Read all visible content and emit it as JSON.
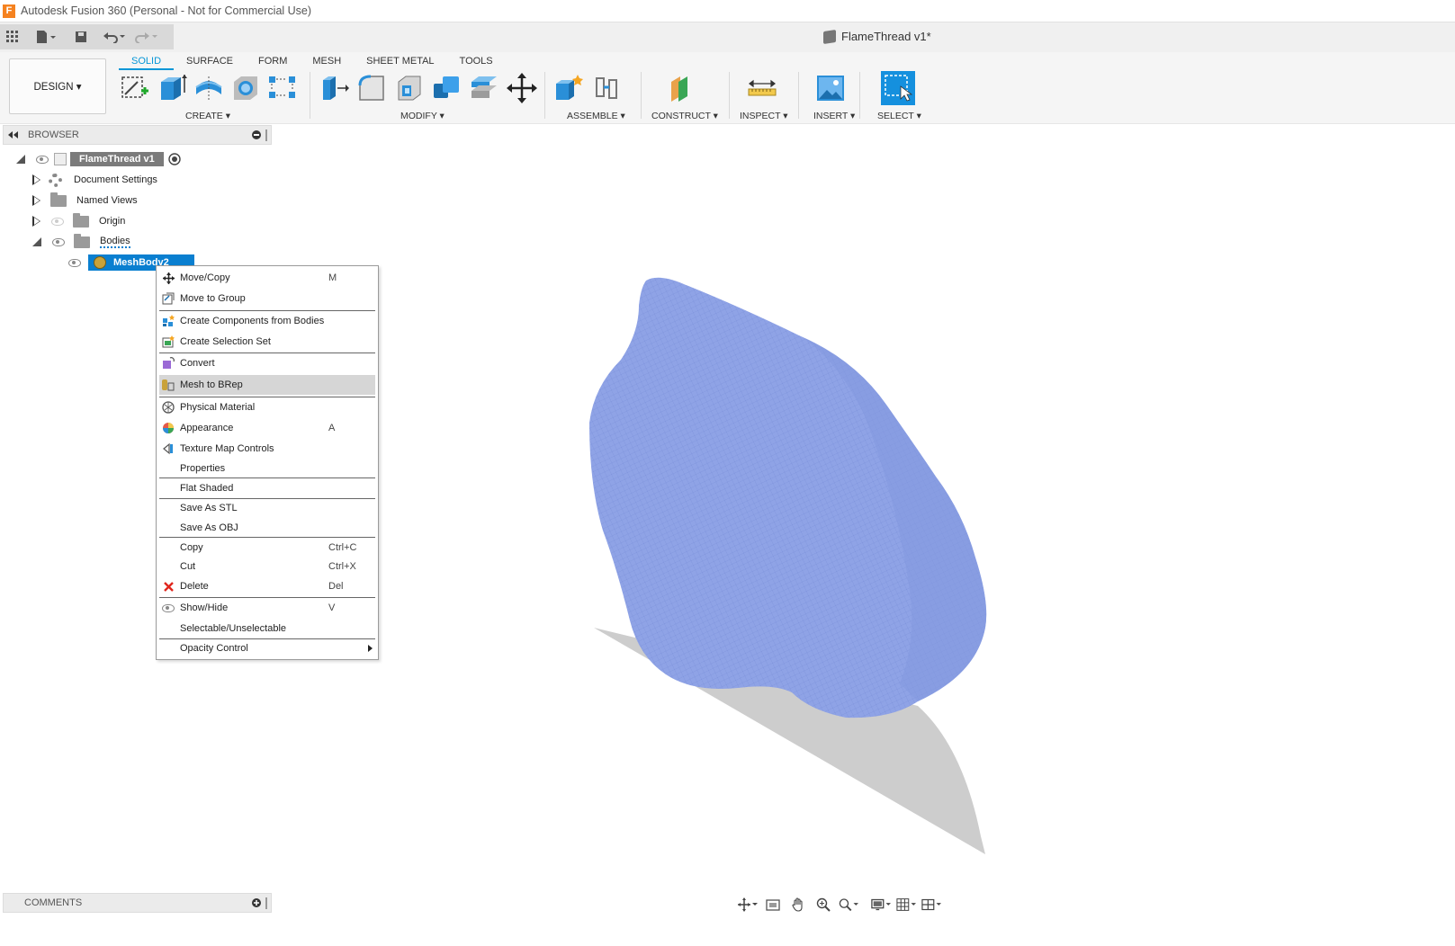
{
  "window": {
    "title": "Autodesk Fusion 360 (Personal - Not for Commercial Use)",
    "logo_letter": "F"
  },
  "document": {
    "tab_title": "FlameThread v1*"
  },
  "workspace": {
    "label": "DESIGN ▾"
  },
  "tabs": [
    {
      "label": "SOLID",
      "active": true
    },
    {
      "label": "SURFACE",
      "active": false
    },
    {
      "label": "FORM",
      "active": false
    },
    {
      "label": "MESH",
      "active": false
    },
    {
      "label": "SHEET METAL",
      "active": false
    },
    {
      "label": "TOOLS",
      "active": false
    }
  ],
  "groups": {
    "create": "CREATE ▾",
    "modify": "MODIFY ▾",
    "assemble": "ASSEMBLE ▾",
    "construct": "CONSTRUCT ▾",
    "inspect": "INSPECT ▾",
    "insert": "INSERT ▾",
    "select": "SELECT ▾"
  },
  "browser": {
    "title": "BROWSER",
    "root": "FlameThread v1",
    "items": {
      "document_settings": "Document Settings",
      "named_views": "Named Views",
      "origin": "Origin",
      "bodies": "Bodies",
      "mesh_body": "MeshBody2"
    }
  },
  "context_menu": {
    "items": [
      {
        "label": "Move/Copy",
        "shortcut": "M",
        "icon": "move-icon"
      },
      {
        "label": "Move to Group",
        "shortcut": "",
        "icon": "move-to-group-icon"
      },
      {
        "label": "Create Components from Bodies",
        "shortcut": "",
        "icon": "components-icon"
      },
      {
        "label": "Create Selection Set",
        "shortcut": "",
        "icon": "selection-set-icon"
      },
      {
        "label": "Convert",
        "shortcut": "",
        "icon": "convert-icon"
      },
      {
        "label": "Mesh to BRep",
        "shortcut": "",
        "icon": "mesh-to-brep-icon",
        "highlighted": true
      },
      {
        "label": "Physical Material",
        "shortcut": "",
        "icon": "physical-material-icon"
      },
      {
        "label": "Appearance",
        "shortcut": "A",
        "icon": "appearance-icon"
      },
      {
        "label": "Texture Map Controls",
        "shortcut": "",
        "icon": "texture-map-icon"
      },
      {
        "label": "Properties",
        "shortcut": ""
      },
      {
        "label": "Flat Shaded",
        "shortcut": ""
      },
      {
        "label": "Save As STL",
        "shortcut": ""
      },
      {
        "label": "Save As OBJ",
        "shortcut": ""
      },
      {
        "label": "Copy",
        "shortcut": "Ctrl+C"
      },
      {
        "label": "Cut",
        "shortcut": "Ctrl+X"
      },
      {
        "label": "Delete",
        "shortcut": "Del",
        "icon": "delete-icon"
      },
      {
        "label": "Show/Hide",
        "shortcut": "V",
        "icon": "eye-icon"
      },
      {
        "label": "Selectable/Unselectable",
        "shortcut": ""
      },
      {
        "label": "Opacity Control",
        "shortcut": ""
      }
    ]
  },
  "comments": {
    "title": "COMMENTS"
  },
  "colors": {
    "accent": "#0696d7",
    "mesh_body": "#8fa3e6",
    "selected_item": "#0a7fd0",
    "menu_highlight": "#d6d6d6",
    "shadow": "#cfcfcf"
  }
}
